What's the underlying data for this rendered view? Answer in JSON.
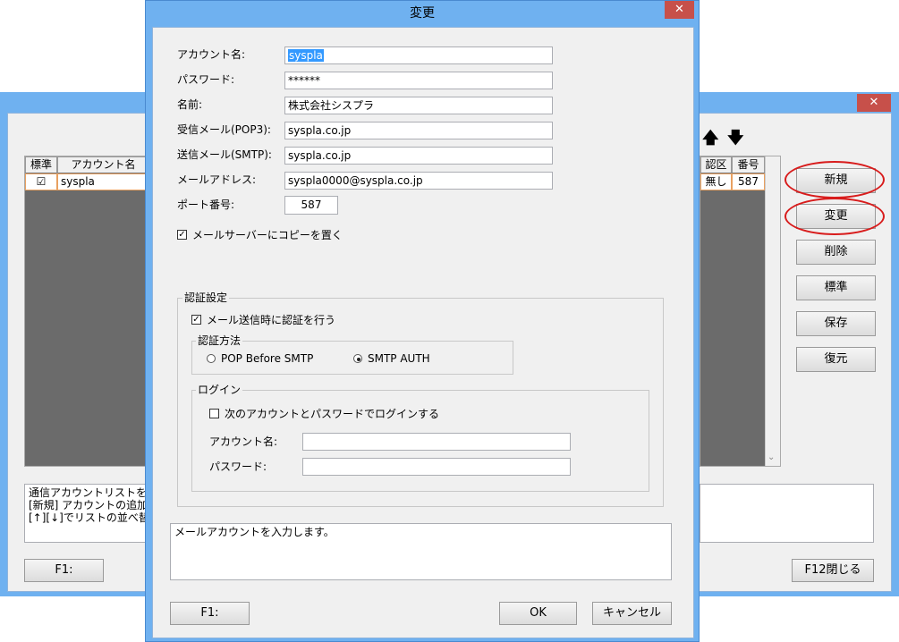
{
  "background_window": {
    "close_glyph": "✕",
    "arrows": [
      "🡅",
      "🡇"
    ],
    "list": {
      "columns": [
        "標準",
        "アカウント名",
        "認区",
        "番号"
      ],
      "rows": [
        {
          "default_mark": "☑",
          "account": "syspla",
          "auth": "無し",
          "number": "587"
        }
      ]
    },
    "buttons": {
      "new": "新規",
      "change": "変更",
      "delete": "削除",
      "default": "標準",
      "save": "保存",
      "restore": "復元",
      "f1": "F1:",
      "f12": "F12閉じる"
    },
    "help_text": [
      "通信アカウントリストを表示しま",
      "[新規] アカウントの追加 [変",
      "[↑][↓]でリストの並べ替え"
    ]
  },
  "dialog": {
    "title": "変更",
    "close_glyph": "✕",
    "fields": {
      "account_name": {
        "label": "アカウント名:",
        "value": "syspla"
      },
      "password": {
        "label": "パスワード:",
        "value": "******"
      },
      "name": {
        "label": "名前:",
        "value": "株式会社シスプラ"
      },
      "pop3": {
        "label": "受信メール(POP3):",
        "value": "syspla.co.jp"
      },
      "smtp": {
        "label": "送信メール(SMTP):",
        "value": "syspla.co.jp"
      },
      "email": {
        "label": "メールアドレス:",
        "value": "syspla0000@syspla.co.jp"
      },
      "port": {
        "label": "ポート番号:",
        "value": "587"
      }
    },
    "keep_copy": {
      "label": "メールサーバーにコピーを置く",
      "checked": true,
      "mark": "✓"
    },
    "auth_settings": {
      "title": "認証設定",
      "auth_on_send": {
        "label": "メール送信時に認証を行う",
        "checked": true,
        "mark": "✓"
      },
      "method": {
        "title": "認証方法",
        "options": [
          "POP Before SMTP",
          "SMTP AUTH"
        ],
        "selected": "SMTP AUTH"
      },
      "login": {
        "title": "ログイン",
        "use_login": {
          "label": "次のアカウントとパスワードでログインする",
          "checked": false
        },
        "account_label": "アカウント名:",
        "account_value": "",
        "password_label": "パスワード:",
        "password_value": ""
      }
    },
    "message": "メールアカウントを入力します。",
    "buttons": {
      "f1": "F1:",
      "ok": "OK",
      "cancel": "キャンセル"
    }
  },
  "colors": {
    "title_bar": "#6fb1f0",
    "close": "#c7504a",
    "highlight": "#d81c1c",
    "selection": "#3399ff"
  }
}
